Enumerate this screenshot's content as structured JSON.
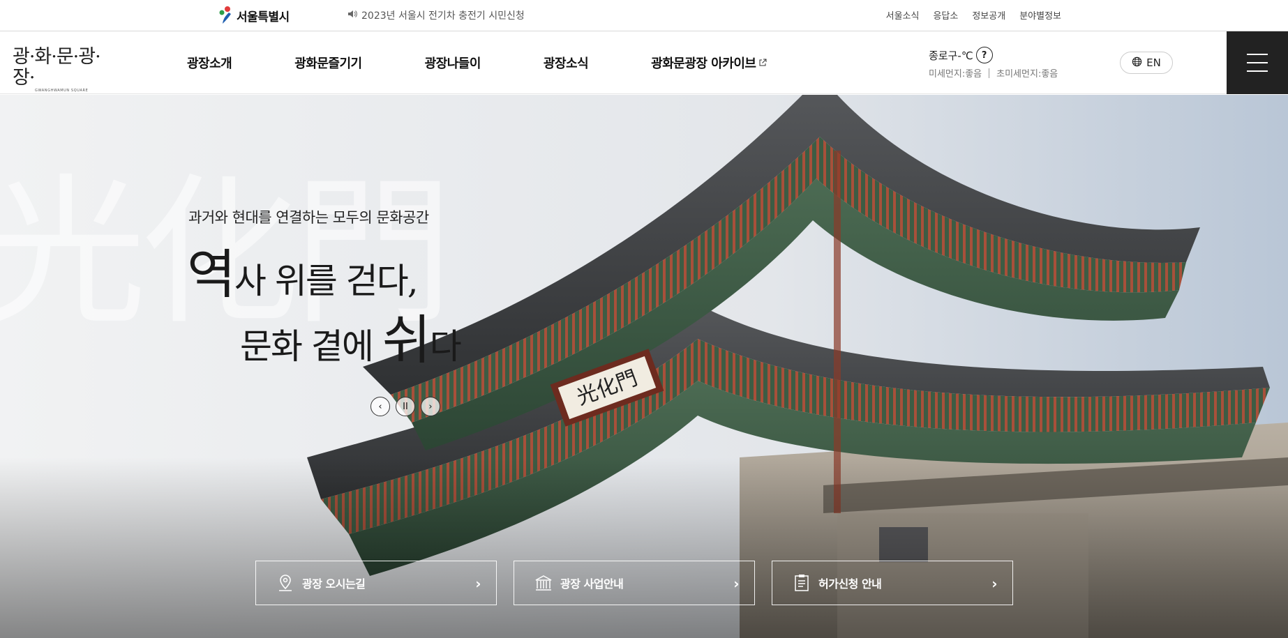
{
  "utility": {
    "seoul_logo": "서울특별시",
    "notice": "2023년 서울시 전기차 충전기 시민신청",
    "links": [
      "서울소식",
      "응답소",
      "정보공개",
      "분야별정보"
    ]
  },
  "header": {
    "logo_ko": "광·화·문·광·장·",
    "logo_en": "GWANGHWAMUN SQUARE",
    "gnb": [
      "광장소개",
      "광화문즐기기",
      "광장나들이",
      "광장소식",
      "광화문광장 아카이브"
    ],
    "weather": {
      "location_temp": "종로구-℃",
      "help": "?",
      "fine_dust": "미세먼지:좋음",
      "ultra_fine_dust": "초미세먼지:좋음"
    },
    "lang": "EN"
  },
  "hero": {
    "watermark": "光化門",
    "subtitle": "과거와 현대를 연결하는 모두의 문화공간",
    "title1_big": "역",
    "title1_rest": "사 위를 걷다,",
    "title2_a": "문화 곁에 ",
    "title2_big": "쉬",
    "title2_b": "다",
    "signboard": "光化門",
    "controls": {
      "prev": "‹",
      "pause": "II",
      "next": "›"
    }
  },
  "quick_links": [
    {
      "label": "광장 오시는길",
      "icon": "location-pin-icon"
    },
    {
      "label": "광장 사업안내",
      "icon": "building-icon"
    },
    {
      "label": "허가신청 안내",
      "icon": "clipboard-icon"
    }
  ],
  "colors": {
    "menu_bg": "#222222",
    "roof_green": "#3b5a45",
    "wood_red": "#8a3b2a"
  }
}
